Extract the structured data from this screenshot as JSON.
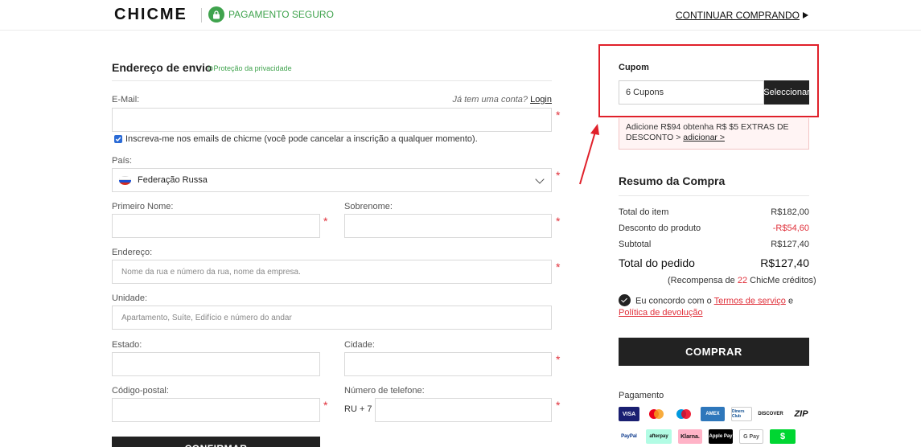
{
  "header": {
    "logo": "CHICME",
    "secure_label": "PAGAMENTO SEGURO",
    "continue_label": "CONTINUAR COMPRANDO"
  },
  "shipping": {
    "title": "Endereço de envio",
    "privacy_label": "⊙Proteção da privacidade",
    "email_label": "E-Mail:",
    "login_hint": "Já tem uma conta?",
    "login_link": "Login",
    "subscribe_label": "Inscreva-me nos emails de chicme (você pode cancelar a inscrição a qualquer momento).",
    "country_label": "País:",
    "country_value": "Federação Russa",
    "first_name_label": "Primeiro Nome:",
    "last_name_label": "Sobrenome:",
    "address_label": "Endereço:",
    "address_placeholder": "Nome da rua e número da rua, nome da empresa.",
    "unit_label": "Unidade:",
    "unit_placeholder": "Apartamento, Suíte, Edifício e número do andar",
    "state_label": "Estado:",
    "city_label": "Cidade:",
    "zip_label": "Código-postal:",
    "phone_label": "Número de telefone:",
    "phone_prefix": "RU + 7",
    "confirm_label": "CONFIRMAR",
    "required_mark": "*"
  },
  "coupon": {
    "title": "Cupom",
    "field_value": "6 Cupons",
    "select_label": "Seleccionar",
    "promo_text": "Adicione R$94 obtenha R$ $5 EXTRAS DE DESCONTO >",
    "promo_link": "adicionar >"
  },
  "summary": {
    "title": "Resumo da Compra",
    "rows": [
      {
        "label": "Total do item",
        "value": "R$182,00"
      },
      {
        "label": "Desconto do produto",
        "value": "-R$54,60"
      },
      {
        "label": "Subtotal",
        "value": "R$127,40"
      },
      {
        "label": "Total do pedido",
        "value": "R$127,40"
      }
    ],
    "reward_prefix": "(Recompensa de",
    "reward_points": "22",
    "reward_suffix": "ChicMe créditos)",
    "agree_prefix": "Eu concordo com o",
    "terms_link": "Termos de serviço",
    "agree_join": "e",
    "return_link": "Política de devolução",
    "buy_label": "COMPRAR"
  },
  "payment": {
    "title": "Pagamento",
    "methods_row1": [
      "VISA",
      "mastercard",
      "maestro",
      "AMEX",
      "Diners Club",
      "DISCOVER",
      "ZIP"
    ],
    "methods_row2": [
      "PayPal",
      "afterpay",
      "Klarna.",
      "Apple Pay",
      "G Pay",
      "$"
    ]
  },
  "colors": {
    "green": "#3fa34d",
    "red": "#e0313b",
    "dark": "#222222",
    "highlight_box": "#e0202a"
  }
}
